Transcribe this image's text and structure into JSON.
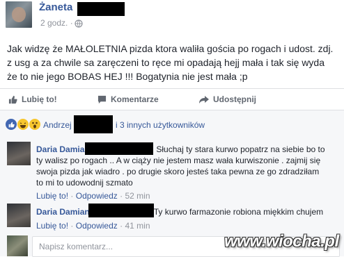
{
  "post": {
    "author": "Żaneta",
    "time": "2 godz. ·",
    "lines": [
      "Jak widzę że MAŁOLETNIA pizda ktora waliła gościa po rogach i udost. zdj.",
      "z usg a za chwile sa zaręczeni to ręce mi opadają hejj mała i tak się wyda",
      "że to nie jego BOBAS HEJ !!! Bogatynia nie jest mała ;p"
    ]
  },
  "actions": {
    "like": "Lubię to!",
    "comment": "Komentarze",
    "share": "Udostępnij"
  },
  "reactions": {
    "icons": [
      "like-icon",
      "haha-icon",
      "wow-icon"
    ],
    "first_name": "Andrzej",
    "others": "i 3 innych użytkowników"
  },
  "comments": [
    {
      "author": "Daria Damia",
      "lines": [
        "Słuchaj ty stara kurwo popatrz na siebie bo to",
        "ty walisz po rogach .. A w ciąży nie jestem masz wała kurwiszonie . zajmij się",
        "swoja pizda jak wiadro . po drugie skoro jesteś taka pewna ze go zdradziłam",
        "to mi to udowodnij szmato"
      ],
      "like": "Lubię to!",
      "reply": "Odpowiedz",
      "time": "52 min"
    },
    {
      "author": "Daria Damian",
      "lines": [
        "Ty kurwo farmazonie robiona miękkim chujem"
      ],
      "like": "Lubię to!",
      "reply": "Odpowiedz",
      "time": "41 min"
    }
  ],
  "composer": {
    "placeholder": "Napisz komentarz..."
  },
  "watermark": "www.wiocha.pl",
  "colors": {
    "link": "#365899",
    "meta": "#90949c",
    "text": "#1d2129",
    "comments_bg": "#f6f7f9",
    "redaction": "#000000"
  }
}
